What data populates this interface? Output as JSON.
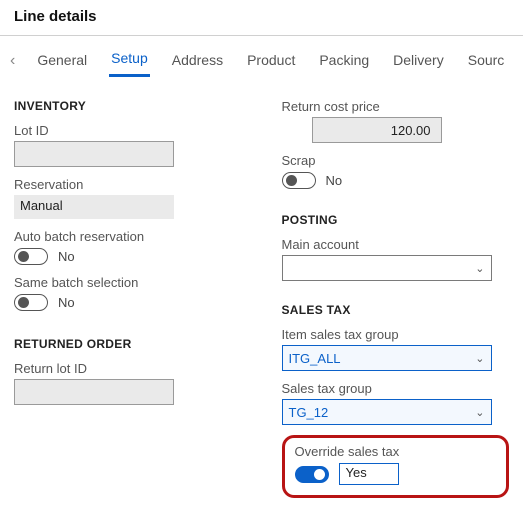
{
  "page": {
    "title": "Line details"
  },
  "tabs": {
    "items": [
      "General",
      "Setup",
      "Address",
      "Product",
      "Packing",
      "Delivery",
      "Sourc"
    ],
    "activeIndex": 1
  },
  "inventory": {
    "heading": "INVENTORY",
    "lotId": {
      "label": "Lot ID",
      "value": ""
    },
    "reservation": {
      "label": "Reservation",
      "value": "Manual"
    },
    "autoBatch": {
      "label": "Auto batch reservation",
      "value": "No",
      "on": false
    },
    "sameBatch": {
      "label": "Same batch selection",
      "value": "No",
      "on": false
    }
  },
  "returned": {
    "heading": "RETURNED ORDER",
    "returnLotId": {
      "label": "Return lot ID",
      "value": ""
    }
  },
  "returnCost": {
    "label": "Return cost price",
    "value": "120.00"
  },
  "scrap": {
    "label": "Scrap",
    "value": "No",
    "on": false
  },
  "posting": {
    "heading": "POSTING",
    "mainAccount": {
      "label": "Main account",
      "value": ""
    }
  },
  "salesTax": {
    "heading": "SALES TAX",
    "itemGroup": {
      "label": "Item sales tax group",
      "value": "ITG_ALL"
    },
    "group": {
      "label": "Sales tax group",
      "value": "TG_12"
    },
    "override": {
      "label": "Override sales tax",
      "value": "Yes",
      "on": true
    }
  }
}
